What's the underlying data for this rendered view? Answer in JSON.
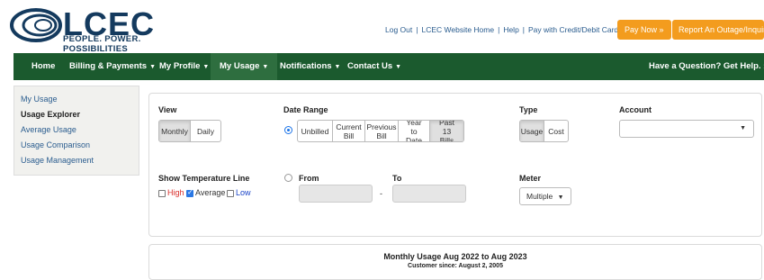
{
  "header": {
    "logo_text": "LCEC",
    "logo_tagline": "PEOPLE. POWER. POSSIBILITIES",
    "links": [
      "Log Out",
      "LCEC Website Home",
      "Help",
      "Pay with Credit/Debit Card"
    ],
    "pay_now": "Pay Now »",
    "report_outage": "Report An Outage/Inquiry"
  },
  "nav": {
    "items": [
      "Home",
      "Billing & Payments",
      "My Profile",
      "My Usage",
      "Notifications",
      "Contact Us"
    ],
    "help": "Have a Question? Get Help. »",
    "active": "My Usage"
  },
  "sidebar": {
    "items": [
      "My Usage",
      "Usage Explorer",
      "Average Usage",
      "Usage Comparison",
      "Usage Management"
    ],
    "active": "Usage Explorer"
  },
  "controls": {
    "view_label": "View",
    "view_options": [
      "Monthly",
      "Daily"
    ],
    "view_selected": "Monthly",
    "date_range_label": "Date Range",
    "date_range_options": [
      "Unbilled",
      "Current Bill",
      "Previous Bill",
      "Year to Date",
      "Past 13 Bills"
    ],
    "date_range_selected": "Past 13 Bills",
    "type_label": "Type",
    "type_options": [
      "Usage",
      "Cost"
    ],
    "type_selected": "Usage",
    "account_label": "Account",
    "account_value": "",
    "temp_label": "Show Temperature Line",
    "temp_options": [
      {
        "label": "High",
        "checked": false,
        "color": "#d9302c"
      },
      {
        "label": "Average",
        "checked": true,
        "color": "#333333"
      },
      {
        "label": "Low",
        "checked": false,
        "color": "#1a44c8"
      }
    ],
    "from_label": "From",
    "to_label": "To",
    "from_value": "",
    "to_value": "",
    "range_separator": "-",
    "meter_label": "Meter",
    "meter_value": "Multiple"
  },
  "summary": {
    "title": "Monthly Usage Aug 2022 to Aug 2023",
    "subtitle": "Customer since: August 2, 2005"
  },
  "colors": {
    "nav_bg": "#1b5a2e",
    "accent_orange": "#f39c1e",
    "link_blue": "#2b5d8f"
  }
}
